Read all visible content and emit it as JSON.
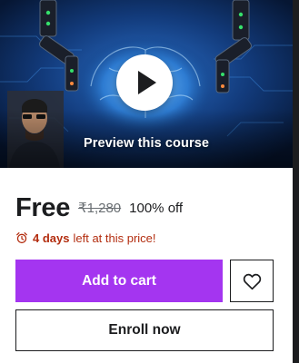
{
  "preview": {
    "label": "Preview this course",
    "play_icon": "play-icon"
  },
  "price": {
    "current": "Free",
    "original": "₹1,280",
    "discount": "100% off"
  },
  "timer": {
    "icon": "alarm-clock-icon",
    "bold_text": "4 days",
    "rest_text": "left at this price!"
  },
  "buttons": {
    "add_to_cart": "Add to cart",
    "wishlist_icon": "heart-icon",
    "enroll_now": "Enroll now"
  },
  "colors": {
    "accent": "#a435f0",
    "text": "#1c1d1f",
    "muted": "#6a6f73",
    "alert": "#b32d0f"
  }
}
